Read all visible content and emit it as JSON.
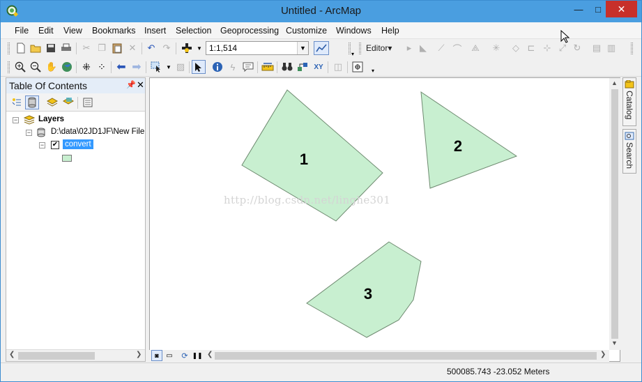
{
  "window": {
    "title": "Untitled - ArcMap",
    "controls": {
      "minimize": "—",
      "maximize": "□",
      "close": "✕"
    }
  },
  "menubar": [
    "File",
    "Edit",
    "View",
    "Bookmarks",
    "Insert",
    "Selection",
    "Geoprocessing",
    "Customize",
    "Windows",
    "Help"
  ],
  "toolbar": {
    "scale_value": "1:1,514",
    "editor_label": "Editor▾"
  },
  "toc": {
    "title": "Table Of Contents",
    "layers_root": "Layers",
    "data_path": "D:\\data\\02JD1JF\\New File",
    "layer_name": "convert",
    "layer_checked": true,
    "symbol_fill": "#c8efd0"
  },
  "map": {
    "watermark": "http://blog.csdn.net/linghe301",
    "fill_color": "#c8efd0",
    "stroke_color": "#6e8a70",
    "features": [
      {
        "label": "1"
      },
      {
        "label": "2"
      },
      {
        "label": "3"
      }
    ]
  },
  "side_tabs": {
    "catalog": "Catalog",
    "search": "Search"
  },
  "status": {
    "coordinates": "500085.743  -23.052 Meters"
  }
}
